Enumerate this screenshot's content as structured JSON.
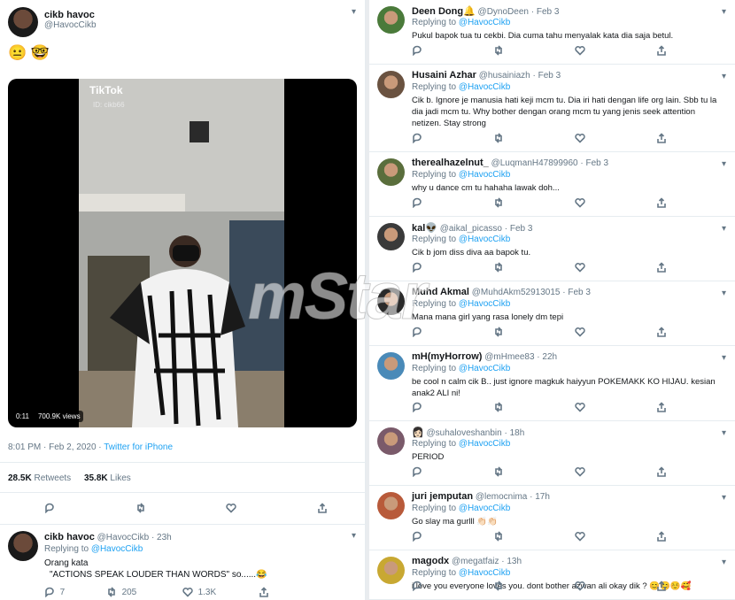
{
  "main_tweet": {
    "name": "cikb havoc",
    "handle": "@HavocCikb",
    "emojis": [
      "😐",
      "🤓"
    ],
    "video": {
      "watermark": "TikTok",
      "watermark_id": "ID: cikb66",
      "duration": "0:11",
      "views": "700.9K views"
    },
    "timestamp": "8:01 PM · Feb 2, 2020 ·",
    "source": "Twitter for iPhone",
    "retweets_count": "28.5K",
    "retweets_label": "Retweets",
    "likes_count": "35.8K",
    "likes_label": "Likes"
  },
  "self_reply": {
    "name": "cikb havoc",
    "handle": "@HavocCikb",
    "time": "· 23h",
    "replying_prefix": "Replying to",
    "replying_to": "@HavocCikb",
    "line1": "Orang kata",
    "line2": "\"ACTIONS SPEAK LOUDER THAN WORDS\" so......😂",
    "replies": "7",
    "retweets": "205",
    "likes": "1.3K"
  },
  "watermark": "mStar",
  "replies": [
    {
      "name": "Deen Dong🔔",
      "handle": "@DynoDeen",
      "time": "· Feb 3",
      "replying_prefix": "Replying to",
      "replying_to": "@HavocCikb",
      "text": "Pukul bapok tua tu cekbi. Dia cuma tahu menyalak kata dia saja betul.",
      "avatar_color": "#4a7a3a"
    },
    {
      "name": "Husaini Azhar",
      "handle": "@husainiazh",
      "time": "· Feb 3",
      "replying_prefix": "Replying to",
      "replying_to": "@HavocCikb",
      "text": "Cik b. Ignore je manusia hati keji mcm tu. Dia iri hati dengan life org lain. Sbb tu la dia jadi mcm tu. Why bother dengan orang mcm tu yang jenis seek attention netizen. Stay strong",
      "avatar_color": "#6a5240"
    },
    {
      "name": "therealhazelnut_",
      "handle": "@LuqmanH47899960",
      "time": "· Feb 3",
      "replying_prefix": "Replying to",
      "replying_to": "@HavocCikb",
      "text": "why u dance cm tu hahaha lawak doh...",
      "avatar_color": "#5a6e3c"
    },
    {
      "name": "kal👽",
      "handle": "@aikal_picasso",
      "time": "· Feb 3",
      "replying_prefix": "Replying to",
      "replying_to": "@HavocCikb",
      "text": "Cik b jom diss diva aa bapok tu.",
      "avatar_color": "#3a3a3a"
    },
    {
      "name": "Muhd Akmal",
      "handle": "@MuhdAkm52913015",
      "time": "· Feb 3",
      "replying_prefix": "Replying to",
      "replying_to": "@HavocCikb",
      "text": "Mana mana girl yang rasa lonely dm tepi",
      "avatar_color": "#2a2a2a"
    },
    {
      "name": "mH(myHorrow)",
      "handle": "@mHmee83",
      "time": "· 22h",
      "replying_prefix": "Replying to",
      "replying_to": "@HavocCikb",
      "text": "be cool n calm cik B.. just ignore magkuk haiyyun POKEMAKK KO HIJAU. kesian anak2 ALI ni!",
      "avatar_color": "#4a8ab8"
    },
    {
      "name": "👩🏻",
      "handle": "@suhaloveshanbin",
      "time": "· 18h",
      "replying_prefix": "Replying to",
      "replying_to": "@HavocCikb",
      "text": "PERIOD",
      "avatar_color": "#7a5a6a"
    },
    {
      "name": "juri jemputan",
      "handle": "@lemocnima",
      "time": "· 17h",
      "replying_prefix": "Replying to",
      "replying_to": "@HavocCikb",
      "text": "Go slay ma gurlll 👏🏻👏🏻",
      "avatar_color": "#b85a3a"
    },
    {
      "name": "magodx",
      "handle": "@megatfaiz",
      "time": "· 13h",
      "replying_prefix": "Replying to",
      "replying_to": "@HavocCikb",
      "text": "i love you everyone loves you. dont bother azwan ali okay dik ? 😊😊☺️🥰",
      "avatar_color": "#c8a832"
    }
  ]
}
